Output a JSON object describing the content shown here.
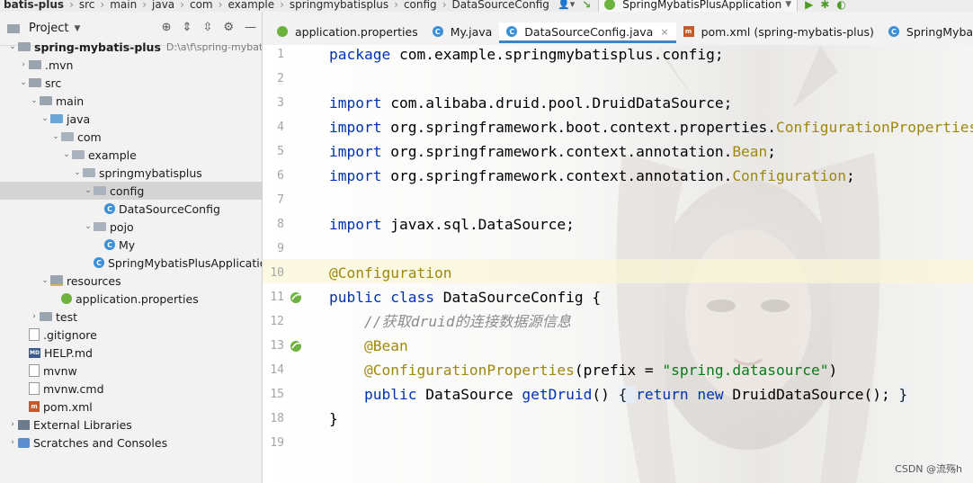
{
  "breadcrumb": [
    "batis-plus",
    "src",
    "main",
    "java",
    "com",
    "example",
    "springmybatisplus",
    "config",
    "DataSourceConfig"
  ],
  "run_config": "SpringMybatisPlusApplication",
  "project_panel": {
    "title": "Project",
    "tree": [
      {
        "label": "spring-mybatis-plus",
        "extra": "D:\\a\\f\\spring-mybatis-plus",
        "icon": "module-folder-icon",
        "indent": 0,
        "expanded": true,
        "bold": true
      },
      {
        "label": ".mvn",
        "icon": "folder-icon",
        "indent": 1,
        "expanded": false
      },
      {
        "label": "src",
        "icon": "folder-icon",
        "indent": 1,
        "expanded": true
      },
      {
        "label": "main",
        "icon": "folder-icon",
        "indent": 2,
        "expanded": true
      },
      {
        "label": "java",
        "icon": "source-folder-icon",
        "indent": 3,
        "expanded": true
      },
      {
        "label": "com",
        "icon": "package-icon",
        "indent": 4,
        "expanded": true
      },
      {
        "label": "example",
        "icon": "package-icon",
        "indent": 5,
        "expanded": true
      },
      {
        "label": "springmybatisplus",
        "icon": "package-icon",
        "indent": 6,
        "expanded": true
      },
      {
        "label": "config",
        "icon": "package-icon",
        "indent": 7,
        "expanded": true,
        "selected": true
      },
      {
        "label": "DataSourceConfig",
        "icon": "class-icon",
        "indent": 8
      },
      {
        "label": "pojo",
        "icon": "package-icon",
        "indent": 7,
        "expanded": true
      },
      {
        "label": "My",
        "icon": "class-icon",
        "indent": 8
      },
      {
        "label": "SpringMybatisPlusApplication",
        "icon": "class-icon",
        "indent": 7
      },
      {
        "label": "resources",
        "icon": "resources-folder-icon",
        "indent": 3,
        "expanded": true
      },
      {
        "label": "application.properties",
        "icon": "spring-properties-icon",
        "indent": 4
      },
      {
        "label": "test",
        "icon": "folder-icon",
        "indent": 2,
        "expanded": false
      },
      {
        "label": ".gitignore",
        "icon": "file-icon",
        "indent": 1
      },
      {
        "label": "HELP.md",
        "icon": "markdown-icon",
        "indent": 1
      },
      {
        "label": "mvnw",
        "icon": "file-icon",
        "indent": 1
      },
      {
        "label": "mvnw.cmd",
        "icon": "file-icon",
        "indent": 1
      },
      {
        "label": "pom.xml",
        "icon": "maven-icon",
        "indent": 1
      },
      {
        "label": "External Libraries",
        "icon": "libraries-icon",
        "indent": 0,
        "expanded": false
      },
      {
        "label": "Scratches and Consoles",
        "icon": "scratches-icon",
        "indent": 0,
        "expanded": false
      }
    ]
  },
  "tabs": [
    {
      "label": "application.properties",
      "icon": "spring-properties-icon",
      "active": false
    },
    {
      "label": "My.java",
      "icon": "class-icon",
      "active": false
    },
    {
      "label": "DataSourceConfig.java",
      "icon": "class-icon",
      "active": true
    },
    {
      "label": "pom.xml (spring-mybatis-plus)",
      "icon": "maven-icon",
      "active": false
    },
    {
      "label": "SpringMybat",
      "icon": "class-icon",
      "active": false
    }
  ],
  "code_lines": [
    [
      {
        "t": "package",
        "c": "kw"
      },
      {
        "t": " com.example.springmybatisplus.config;",
        "c": ""
      }
    ],
    [],
    [
      {
        "t": "import",
        "c": "kw"
      },
      {
        "t": " com.alibaba.druid.pool.DruidDataSource;",
        "c": ""
      }
    ],
    [
      {
        "t": "import",
        "c": "kw"
      },
      {
        "t": " org.springframework.boot.context.properties.",
        "c": ""
      },
      {
        "t": "ConfigurationProperties;",
        "c": "ref"
      }
    ],
    [
      {
        "t": "import",
        "c": "kw"
      },
      {
        "t": " org.springframework.context.annotation.",
        "c": ""
      },
      {
        "t": "Bean",
        "c": "ref"
      },
      {
        "t": ";",
        "c": ""
      }
    ],
    [
      {
        "t": "import",
        "c": "kw"
      },
      {
        "t": " org.springframework.context.annotation.",
        "c": ""
      },
      {
        "t": "Configuration",
        "c": "ref"
      },
      {
        "t": ";",
        "c": ""
      }
    ],
    [],
    [
      {
        "t": "import",
        "c": "kw"
      },
      {
        "t": " javax.sql.DataSource;",
        "c": ""
      }
    ],
    [],
    [
      {
        "t": "@Configuration",
        "c": "ann"
      }
    ],
    [
      {
        "t": "public class",
        "c": "kw"
      },
      {
        "t": " DataSourceConfig {",
        "c": ""
      }
    ],
    [
      {
        "t": "    //获取druid的连接数据源信息",
        "c": "cmt"
      }
    ],
    [
      {
        "t": "    @Bean",
        "c": "ann"
      }
    ],
    [
      {
        "t": "    @ConfigurationProperties",
        "c": "ann"
      },
      {
        "t": "(prefix = ",
        "c": ""
      },
      {
        "t": "\"spring.datasource\"",
        "c": "str"
      },
      {
        "t": ")",
        "c": ""
      }
    ],
    [
      {
        "t": "    ",
        "c": ""
      },
      {
        "t": "public",
        "c": "kw"
      },
      {
        "t": " DataSource ",
        "c": ""
      },
      {
        "t": "getDruid",
        "c": "kw"
      },
      {
        "t": "() ",
        "c": ""
      },
      {
        "t": "{ ",
        "c": "fold"
      },
      {
        "t": "return new",
        "c": "kw"
      },
      {
        "t": " DruidDataSource(); ",
        "c": ""
      },
      {
        "t": "}",
        "c": "fold"
      }
    ],
    [
      {
        "t": "}",
        "c": ""
      }
    ],
    []
  ],
  "line_numbers": [
    "1",
    "2",
    "3",
    "4",
    "5",
    "6",
    "7",
    "8",
    "9",
    "10",
    "11",
    "12",
    "13",
    "14",
    "15",
    "18",
    "19"
  ],
  "gutter_icons": [
    {
      "line": 11,
      "icon": "spring-bean-config-icon"
    },
    {
      "line": 13,
      "icon": "spring-bean-icon"
    }
  ],
  "current_line": 10,
  "watermark": "CSDN @流殇h"
}
